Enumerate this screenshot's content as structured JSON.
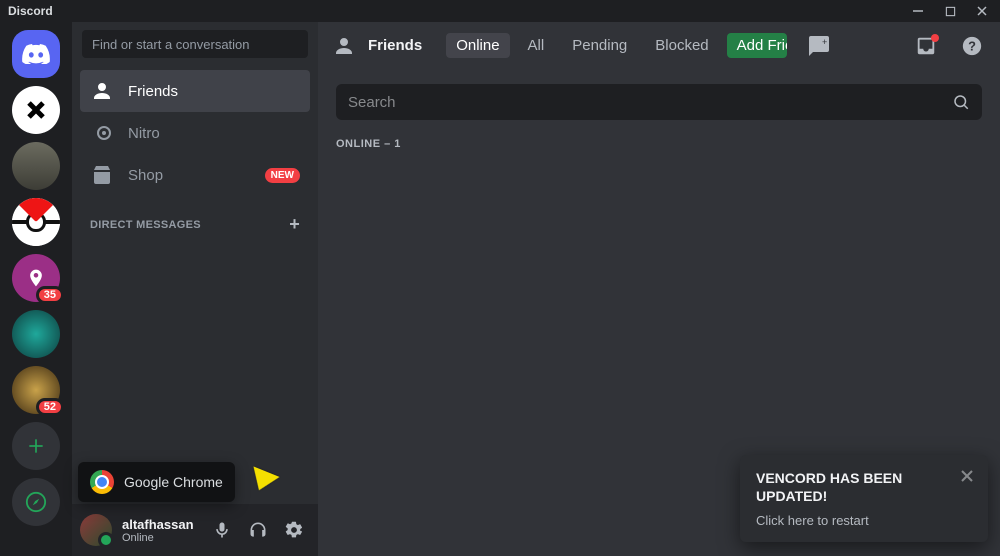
{
  "app": {
    "name": "Discord"
  },
  "window_controls": {
    "min": "–",
    "max": "▭",
    "close": "✕"
  },
  "sidebar": {
    "find_placeholder": "Find or start a conversation",
    "items": [
      {
        "label": "Friends",
        "icon": "friends-icon",
        "active": true
      },
      {
        "label": "Nitro",
        "icon": "nitro-icon"
      },
      {
        "label": "Shop",
        "icon": "shop-icon",
        "badge": "NEW"
      }
    ],
    "dm_header": "DIRECT MESSAGES"
  },
  "guilds": {
    "home": "home",
    "servers": [
      {
        "name": "server-1",
        "badge": null
      },
      {
        "name": "server-2",
        "badge": null
      },
      {
        "name": "server-3",
        "badge": null
      },
      {
        "name": "server-4",
        "badge": "35"
      },
      {
        "name": "server-5",
        "badge": null
      },
      {
        "name": "server-6",
        "badge": "52"
      }
    ],
    "add": "+",
    "explore": "explore"
  },
  "running_app": {
    "name": "Google Chrome"
  },
  "user": {
    "name": "altafhassan",
    "status": "Online"
  },
  "header": {
    "title": "Friends",
    "tabs": {
      "online": "Online",
      "all": "All",
      "pending": "Pending",
      "blocked": "Blocked",
      "add": "Add Friend"
    }
  },
  "search": {
    "placeholder": "Search"
  },
  "section": {
    "online_count_label": "ONLINE – 1"
  },
  "toast": {
    "title": "VENCORD HAS BEEN UPDATED!",
    "subtitle": "Click here to restart"
  }
}
